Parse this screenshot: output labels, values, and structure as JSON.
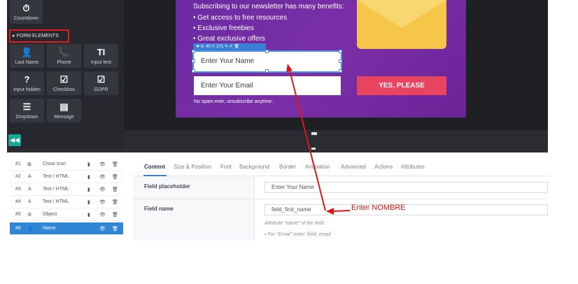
{
  "sidebar": {
    "top_item": {
      "label": "Countdown",
      "icon": "clock-icon"
    },
    "section_label": "FORM ELEMENTS",
    "tiles": [
      {
        "label": "Last Name",
        "icon": "user-plus-icon",
        "glyph": "👤"
      },
      {
        "label": "Phone",
        "icon": "phone-icon",
        "glyph": "📞"
      },
      {
        "label": "Input text",
        "icon": "text-icon",
        "glyph": "TI"
      },
      {
        "label": "Input hidden",
        "icon": "question-icon",
        "glyph": "?"
      },
      {
        "label": "Checkbox",
        "icon": "checkbox-icon",
        "glyph": "☑"
      },
      {
        "label": "GDPR",
        "icon": "checkbox-icon",
        "glyph": "☑"
      },
      {
        "label": "Dropdown",
        "icon": "list-icon",
        "glyph": "☰"
      },
      {
        "label": "Message",
        "icon": "message-icon",
        "glyph": "▤"
      }
    ],
    "collapse_glyph": "◀◀"
  },
  "popup": {
    "intro": "Subscribing to our newsletter has many benefits:",
    "benefits": [
      "• Get access to free resources",
      "• Exclusive freebies",
      "• Great exclusive offers"
    ],
    "name_placeholder": "Enter Your Name",
    "email_placeholder": "Enter Your Email",
    "cta_label": "YES, PLEASE",
    "footnote": "No spam ever, unsubscribe anytime.",
    "selection_tag": "✥ X: 40  Y: 271  ✎ ✐ 🗑"
  },
  "layers": [
    {
      "num": "#1",
      "icon": "close-icon",
      "glyph": "⊠",
      "name": "Close Icon",
      "active": false
    },
    {
      "num": "#2",
      "icon": "text-icon",
      "glyph": "A",
      "name": "Text / HTML",
      "active": false
    },
    {
      "num": "#3",
      "icon": "text-icon",
      "glyph": "A",
      "name": "Text / HTML",
      "active": false
    },
    {
      "num": "#4",
      "icon": "text-icon",
      "glyph": "A",
      "name": "Text / HTML",
      "active": false
    },
    {
      "num": "#5",
      "icon": "gear-icon",
      "glyph": "⚙",
      "name": "Object",
      "active": false
    },
    {
      "num": "#6",
      "icon": "user-icon",
      "glyph": "👤",
      "name": "Name",
      "active": true
    }
  ],
  "props": {
    "tabs": [
      "Content",
      "Size & Position",
      "Font",
      "Background",
      "Border",
      "Animation",
      "Advanced",
      "Actions",
      "Attributes"
    ],
    "field_placeholder_label": "Field placeholder",
    "field_placeholder_value": "Enter Your Name",
    "field_name_label": "Field name",
    "field_name_value": "field_first_name",
    "hint_attr": "Attribute \"name\" of the field.",
    "hint_example": "•  For \"Email\" enter: field_email"
  },
  "annotation": {
    "text": "Enter NOMBRE",
    "color": "#d81919"
  },
  "colors": {
    "accent": "#2f86d6",
    "cta": "#e8435f",
    "popup": "#6a2aa3"
  }
}
